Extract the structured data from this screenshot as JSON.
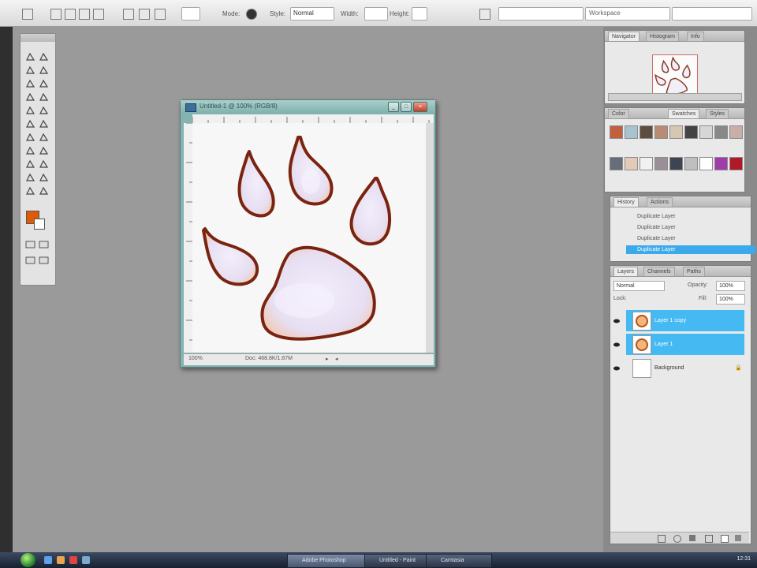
{
  "options_bar": {
    "mode_label": "Mode:",
    "style_label": "Style:",
    "style_value": "Normal",
    "width_label": "Width:",
    "height_label": "Height:",
    "workspace_label": "Workspace"
  },
  "document": {
    "title": "Untitled-1 @ 100% (RGB/8)",
    "zoom": "100%",
    "doc_size": "Doc: 468.8K/1.87M"
  },
  "colors": {
    "foreground": "#e05a06",
    "background": "#ffffff",
    "layer_selected": "#44b9f2",
    "history_selected": "#3ca9ea",
    "paw_fill": "#eae6f5",
    "paw_outline": "#7a2410"
  },
  "navigator": {
    "tabs": [
      "Navigator",
      "Histogram",
      "Info"
    ]
  },
  "swatches": {
    "tabs": [
      "Color",
      "Swatches",
      "Styles"
    ],
    "items": [
      "#c1603e",
      "#a7c4ce",
      "#5e4c40",
      "#b98a74",
      "#d6c7b1",
      "#434343",
      "#d6d6d6",
      "#888888",
      "#c7b0a7",
      "#666f78",
      "#e3c9b7",
      "#f1f1f1",
      "#9a8f96",
      "#3f4550",
      "#bfbfbf",
      "#ffffff",
      "#a13ca8",
      "#b01928"
    ]
  },
  "history": {
    "tabs": [
      "History",
      "Actions"
    ],
    "items": [
      "Duplicate Layer",
      "Duplicate Layer",
      "Duplicate Layer",
      "Duplicate Layer"
    ],
    "selected_index": 3
  },
  "layers": {
    "tabs": [
      "Layers",
      "Channels",
      "Paths"
    ],
    "blend_mode": "Normal",
    "opacity_label": "Opacity:",
    "opacity_value": "100%",
    "lock_label": "Lock:",
    "fill_label": "Fill:",
    "fill_value": "100%",
    "items": [
      {
        "name": "Layer 1 copy",
        "selected": true
      },
      {
        "name": "Layer 1",
        "selected": true
      },
      {
        "name": "Background",
        "selected": false
      }
    ]
  },
  "taskbar": {
    "buttons": [
      "Adobe Photoshop",
      "Untitled - Paint",
      "Camtasia"
    ],
    "active_index": 0,
    "clock": "12:31"
  },
  "icons": [
    "marquee-icon",
    "lasso-icon",
    "crop-icon",
    "brush-icon",
    "eraser-icon",
    "gradient-icon",
    "pen-icon",
    "type-icon",
    "hand-icon",
    "zoom-icon",
    "eye-icon",
    "lock-icon",
    "link-icon",
    "trash-icon",
    "new-layer-icon",
    "windows-start-icon"
  ]
}
